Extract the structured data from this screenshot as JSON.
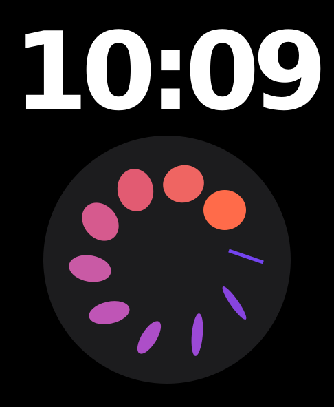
{
  "clock": {
    "time": "10:09"
  },
  "spinner": {
    "segments": [
      {
        "color": "#ff6b4a"
      },
      {
        "color": "#ef6562"
      },
      {
        "color": "#e25b72"
      },
      {
        "color": "#d65a8e"
      },
      {
        "color": "#c95aa5"
      },
      {
        "color": "#bf55b6"
      },
      {
        "color": "#ad4ec8"
      },
      {
        "color": "#9b49d6"
      },
      {
        "color": "#8744df"
      },
      {
        "color": "#7444f0"
      }
    ]
  }
}
